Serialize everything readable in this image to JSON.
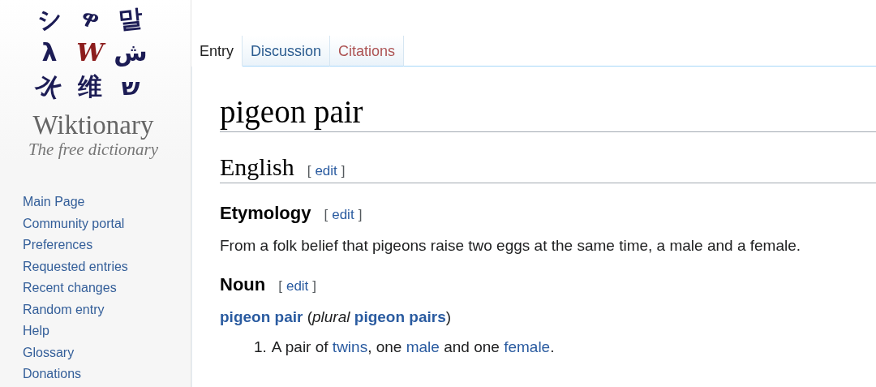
{
  "logo": {
    "tiles": [
      {
        "glyph": "シ"
      },
      {
        "glyph": "ዋ"
      },
      {
        "glyph": "말"
      },
      {
        "glyph": "λ"
      },
      {
        "glyph": "W",
        "kind": "accent"
      },
      {
        "glyph": "ش"
      },
      {
        "glyph": "水"
      },
      {
        "glyph": "维"
      },
      {
        "glyph": "ש"
      }
    ],
    "title": "Wiktionary",
    "tagline": "The free dictionary"
  },
  "sidebar": {
    "items": [
      {
        "label": "Main Page"
      },
      {
        "label": "Community portal"
      },
      {
        "label": "Preferences"
      },
      {
        "label": "Requested entries"
      },
      {
        "label": "Recent changes"
      },
      {
        "label": "Random entry"
      },
      {
        "label": "Help"
      },
      {
        "label": "Glossary"
      },
      {
        "label": "Donations"
      }
    ]
  },
  "tabs": [
    {
      "label": "Entry",
      "selected": true,
      "kind": "normal"
    },
    {
      "label": "Discussion",
      "selected": false,
      "kind": "normal"
    },
    {
      "label": "Citations",
      "selected": false,
      "kind": "missing"
    }
  ],
  "page": {
    "title": "pigeon pair",
    "sections": [
      {
        "kind": "h2",
        "heading": "English",
        "edit": {
          "open": "[",
          "label": "edit",
          "close": "]"
        }
      },
      {
        "kind": "h3",
        "heading": "Etymology",
        "edit": {
          "open": "[",
          "label": "edit",
          "close": "]"
        }
      },
      {
        "kind": "para",
        "segments": [
          {
            "kind": "plain",
            "text": "From a folk belief that pigeons raise two eggs at the same time, a male and a female."
          }
        ]
      },
      {
        "kind": "h3",
        "heading": "Noun",
        "edit": {
          "open": "[",
          "label": "edit",
          "close": "]"
        }
      },
      {
        "kind": "para",
        "segments": [
          {
            "kind": "bold-link",
            "text": "pigeon pair"
          },
          {
            "kind": "plain",
            "text": " ("
          },
          {
            "kind": "italic",
            "text": "plural"
          },
          {
            "kind": "bold-link",
            "text": "pigeon pairs"
          },
          {
            "kind": "plain",
            "text": ")"
          }
        ]
      },
      {
        "kind": "list-item",
        "number": "1.",
        "segments": [
          {
            "kind": "plain",
            "text": "A pair of "
          },
          {
            "kind": "link",
            "text": "twins"
          },
          {
            "kind": "plain",
            "text": ", one "
          },
          {
            "kind": "link",
            "text": "male"
          },
          {
            "kind": "plain",
            "text": " and one "
          },
          {
            "kind": "link",
            "text": "female"
          },
          {
            "kind": "plain",
            "text": "."
          }
        ]
      }
    ]
  }
}
